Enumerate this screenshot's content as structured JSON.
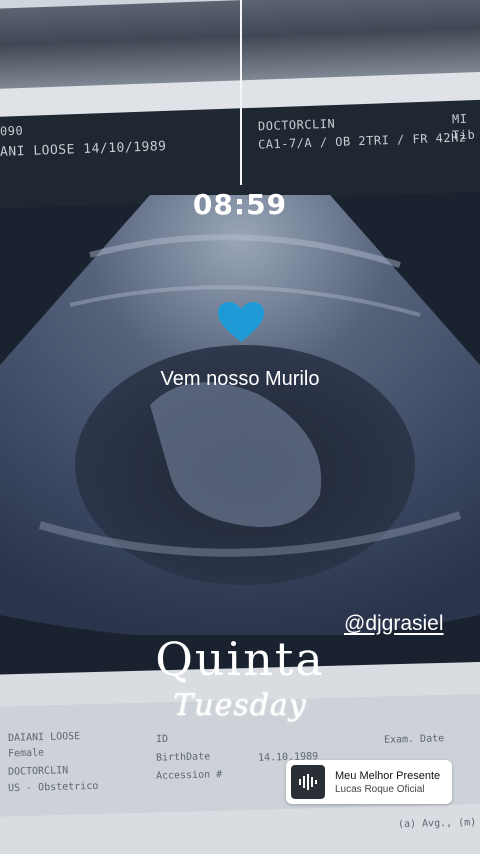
{
  "printout": {
    "header_lines": [
      "090",
      "ANI LOOSE 14/10/1989",
      "DOCTORCLIN",
      "CA1-7/A / OB 2TRI / FR 42Hz",
      "MI",
      "Tib"
    ],
    "footer_lines": [
      "DAIANI LOOSE",
      "Female",
      "DOCTORCLIN",
      "US - Obstetrico",
      "ID",
      "BirthDate",
      "Accession #",
      "14.10.1989",
      "Exam. Date",
      "(a) Avg., (m) l"
    ]
  },
  "story": {
    "time": "08:59",
    "heart_color": "#1e9ad6",
    "heart_icon": "heart-icon",
    "caption": "Vem nosso Murilo",
    "mention": "@djgrasiel",
    "day_label": "Quinta",
    "day_label_en": "Tuesday"
  },
  "music": {
    "song": "Meu Melhor Presente",
    "artist": "Lucas Roque Oficial",
    "icon": "waveform-icon"
  }
}
